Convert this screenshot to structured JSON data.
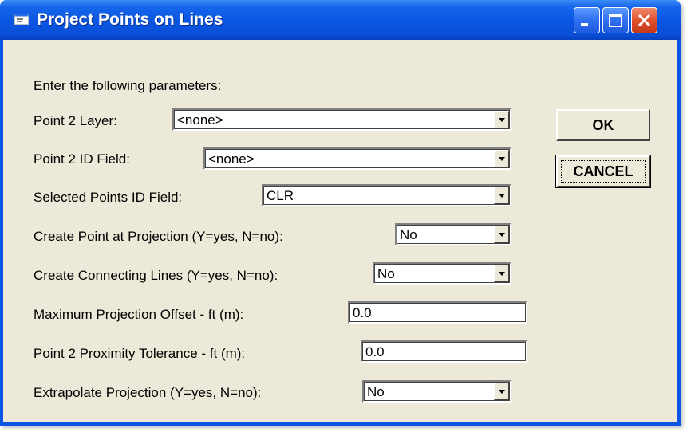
{
  "window": {
    "title": "Project Points on Lines",
    "icon": "dialog-app-icon"
  },
  "titlebar_buttons": {
    "minimize": "minimize-icon",
    "maximize": "maximize-icon",
    "close": "close-icon"
  },
  "form": {
    "intro": "Enter the following parameters:",
    "point2_layer": {
      "label": "Point 2 Layer:",
      "value": "<none>"
    },
    "point2_id_field": {
      "label": "Point 2 ID Field:",
      "value": "<none>"
    },
    "selected_points_id_field": {
      "label": "Selected Points ID Field:",
      "value": "CLR"
    },
    "create_point_at_projection": {
      "label": "Create Point at Projection (Y=yes, N=no):",
      "value": "No"
    },
    "create_connecting_lines": {
      "label": "Create Connecting Lines (Y=yes, N=no):",
      "value": "No"
    },
    "max_projection_offset": {
      "label": "Maximum Projection Offset - ft (m):",
      "value": "0.0"
    },
    "point2_proximity_tolerance": {
      "label": "Point 2 Proximity Tolerance - ft (m):",
      "value": "0.0"
    },
    "extrapolate_projection": {
      "label": "Extrapolate Projection (Y=yes, N=no):",
      "value": "No"
    }
  },
  "buttons": {
    "ok": "OK",
    "cancel": "CANCEL"
  },
  "colors": {
    "titlebar": "#0a55e2",
    "dialog_face": "#ece9d8",
    "close_button": "#e0502b"
  }
}
